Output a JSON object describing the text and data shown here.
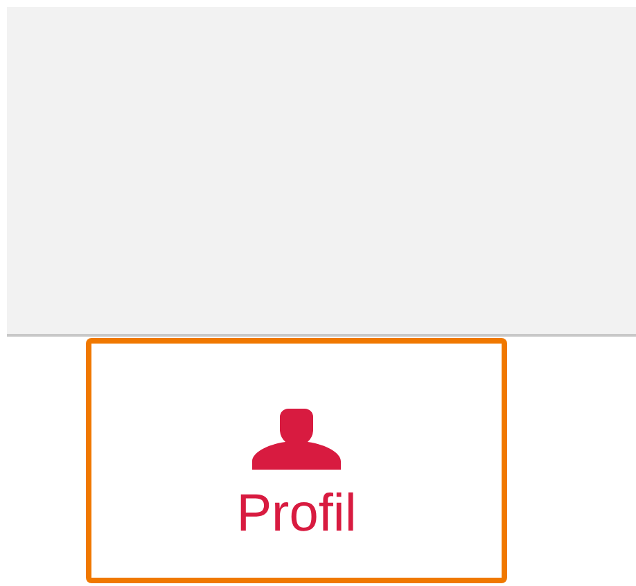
{
  "nav_items": [
    {
      "label": "Profil",
      "highlighted": true
    }
  ]
}
